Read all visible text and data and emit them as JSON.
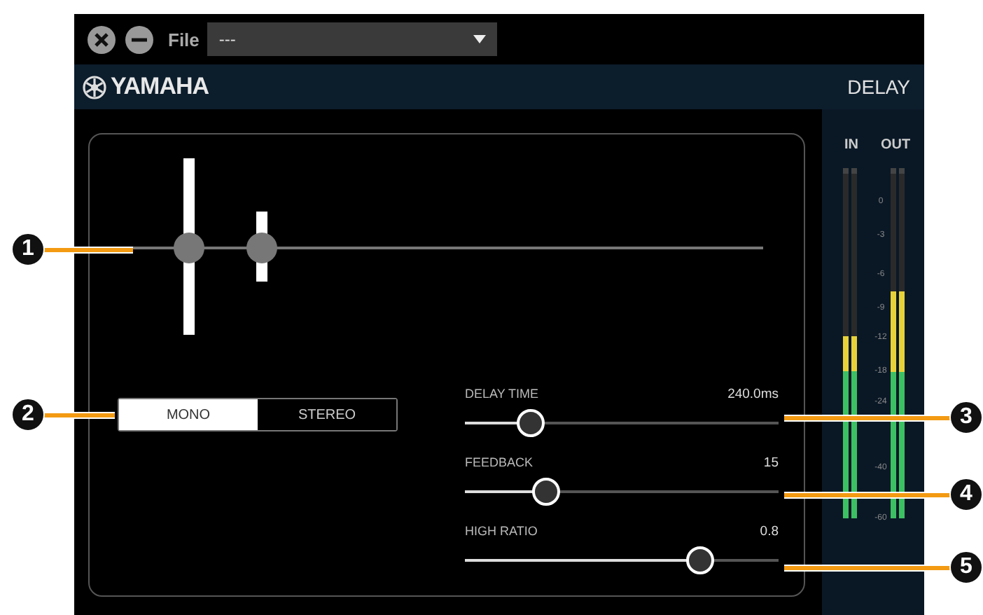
{
  "toolbar": {
    "file_label": "File",
    "file_dropdown": {
      "value": "---"
    }
  },
  "brand_bar": {
    "logo": "YAMAHA",
    "title": "DELAY"
  },
  "mode_buttons": [
    {
      "label": "MONO",
      "selected": true
    },
    {
      "label": "STEREO",
      "selected": false
    }
  ],
  "sliders": [
    {
      "label": "DELAY TIME",
      "reading": "240.0ms",
      "level": 0.21
    },
    {
      "label": "FEEDBACK",
      "reading": "15",
      "level": 0.26
    },
    {
      "label": "HIGH RATIO",
      "reading": "0.8",
      "level": 0.75
    }
  ],
  "meters": [
    {
      "label": "IN"
    },
    {
      "label": "OUT"
    }
  ],
  "meter_scale": [
    "0",
    "-3",
    "-6",
    "-9",
    "-12",
    "-18",
    "-24",
    "-40",
    "-60"
  ],
  "callouts": [
    "1",
    "2",
    "3",
    "4",
    "5"
  ]
}
